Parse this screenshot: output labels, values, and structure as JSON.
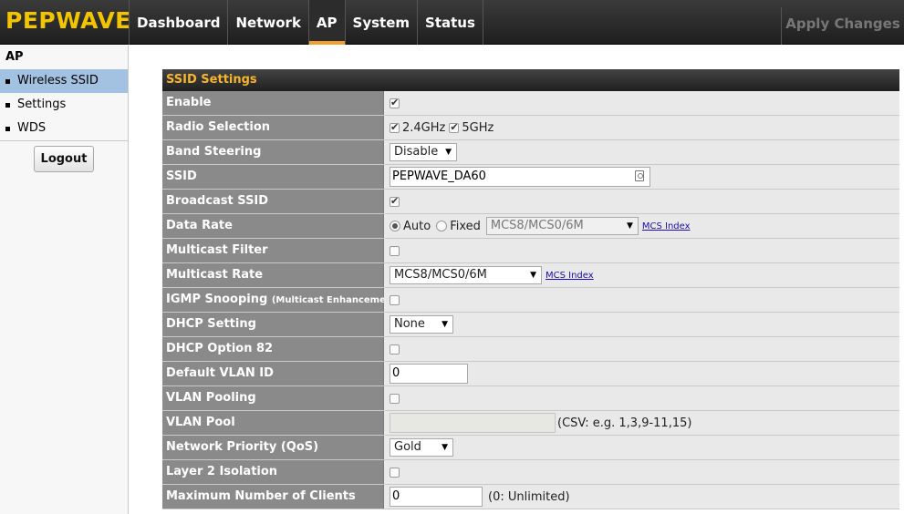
{
  "header": {
    "logo": "PEPWAVE",
    "tabs": [
      {
        "label": "Dashboard"
      },
      {
        "label": "Network"
      },
      {
        "label": "AP"
      },
      {
        "label": "System"
      },
      {
        "label": "Status"
      }
    ],
    "active_tab": "AP",
    "apply_label": "Apply Changes"
  },
  "sidebar": {
    "heading": "AP",
    "items": [
      {
        "label": "Wireless SSID"
      },
      {
        "label": "Settings"
      },
      {
        "label": "WDS"
      }
    ],
    "active_item": "Wireless SSID",
    "logout_label": "Logout"
  },
  "panel": {
    "title": "SSID Settings",
    "rows": {
      "enable": {
        "label": "Enable",
        "checked": true
      },
      "radio": {
        "label": "Radio Selection",
        "opt1": "2.4GHz",
        "opt2": "5GHz"
      },
      "band": {
        "label": "Band Steering",
        "value": "Disable"
      },
      "ssid": {
        "label": "SSID",
        "value": "PEPWAVE_DA60"
      },
      "broadcast": {
        "label": "Broadcast SSID",
        "checked": true
      },
      "datarate": {
        "label": "Data Rate",
        "auto": "Auto",
        "fixed": "Fixed",
        "select": "MCS8/MCS0/6M",
        "link": "MCS Index"
      },
      "mfilter": {
        "label": "Multicast Filter"
      },
      "mrate": {
        "label": "Multicast Rate",
        "select": "MCS8/MCS0/6M",
        "link": "MCS Index"
      },
      "igmp": {
        "label": "IGMP Snooping",
        "sub": "(Multicast Enhancement)"
      },
      "dhcp": {
        "label": "DHCP Setting",
        "value": "None"
      },
      "opt82": {
        "label": "DHCP Option 82"
      },
      "vlanid": {
        "label": "Default VLAN ID",
        "value": "0"
      },
      "vlanpool_en": {
        "label": "VLAN Pooling"
      },
      "vlanpool": {
        "label": "VLAN Pool",
        "value": "",
        "hint": "(CSV: e.g. 1,3,9-11,15)"
      },
      "qos": {
        "label": "Network Priority (QoS)",
        "value": "Gold"
      },
      "l2iso": {
        "label": "Layer 2 Isolation"
      },
      "maxclients": {
        "label": "Maximum Number of Clients",
        "value": "0",
        "hint": "(0: Unlimited)"
      }
    }
  },
  "colors": {
    "logo": "#f2c500",
    "panel_title": "#f7b52c",
    "active_tab_underline": "#f0a030",
    "sidebar_active": "#a3c1e0",
    "label_bg": "#8a8a8a",
    "value_bg": "#e9e9e9"
  }
}
